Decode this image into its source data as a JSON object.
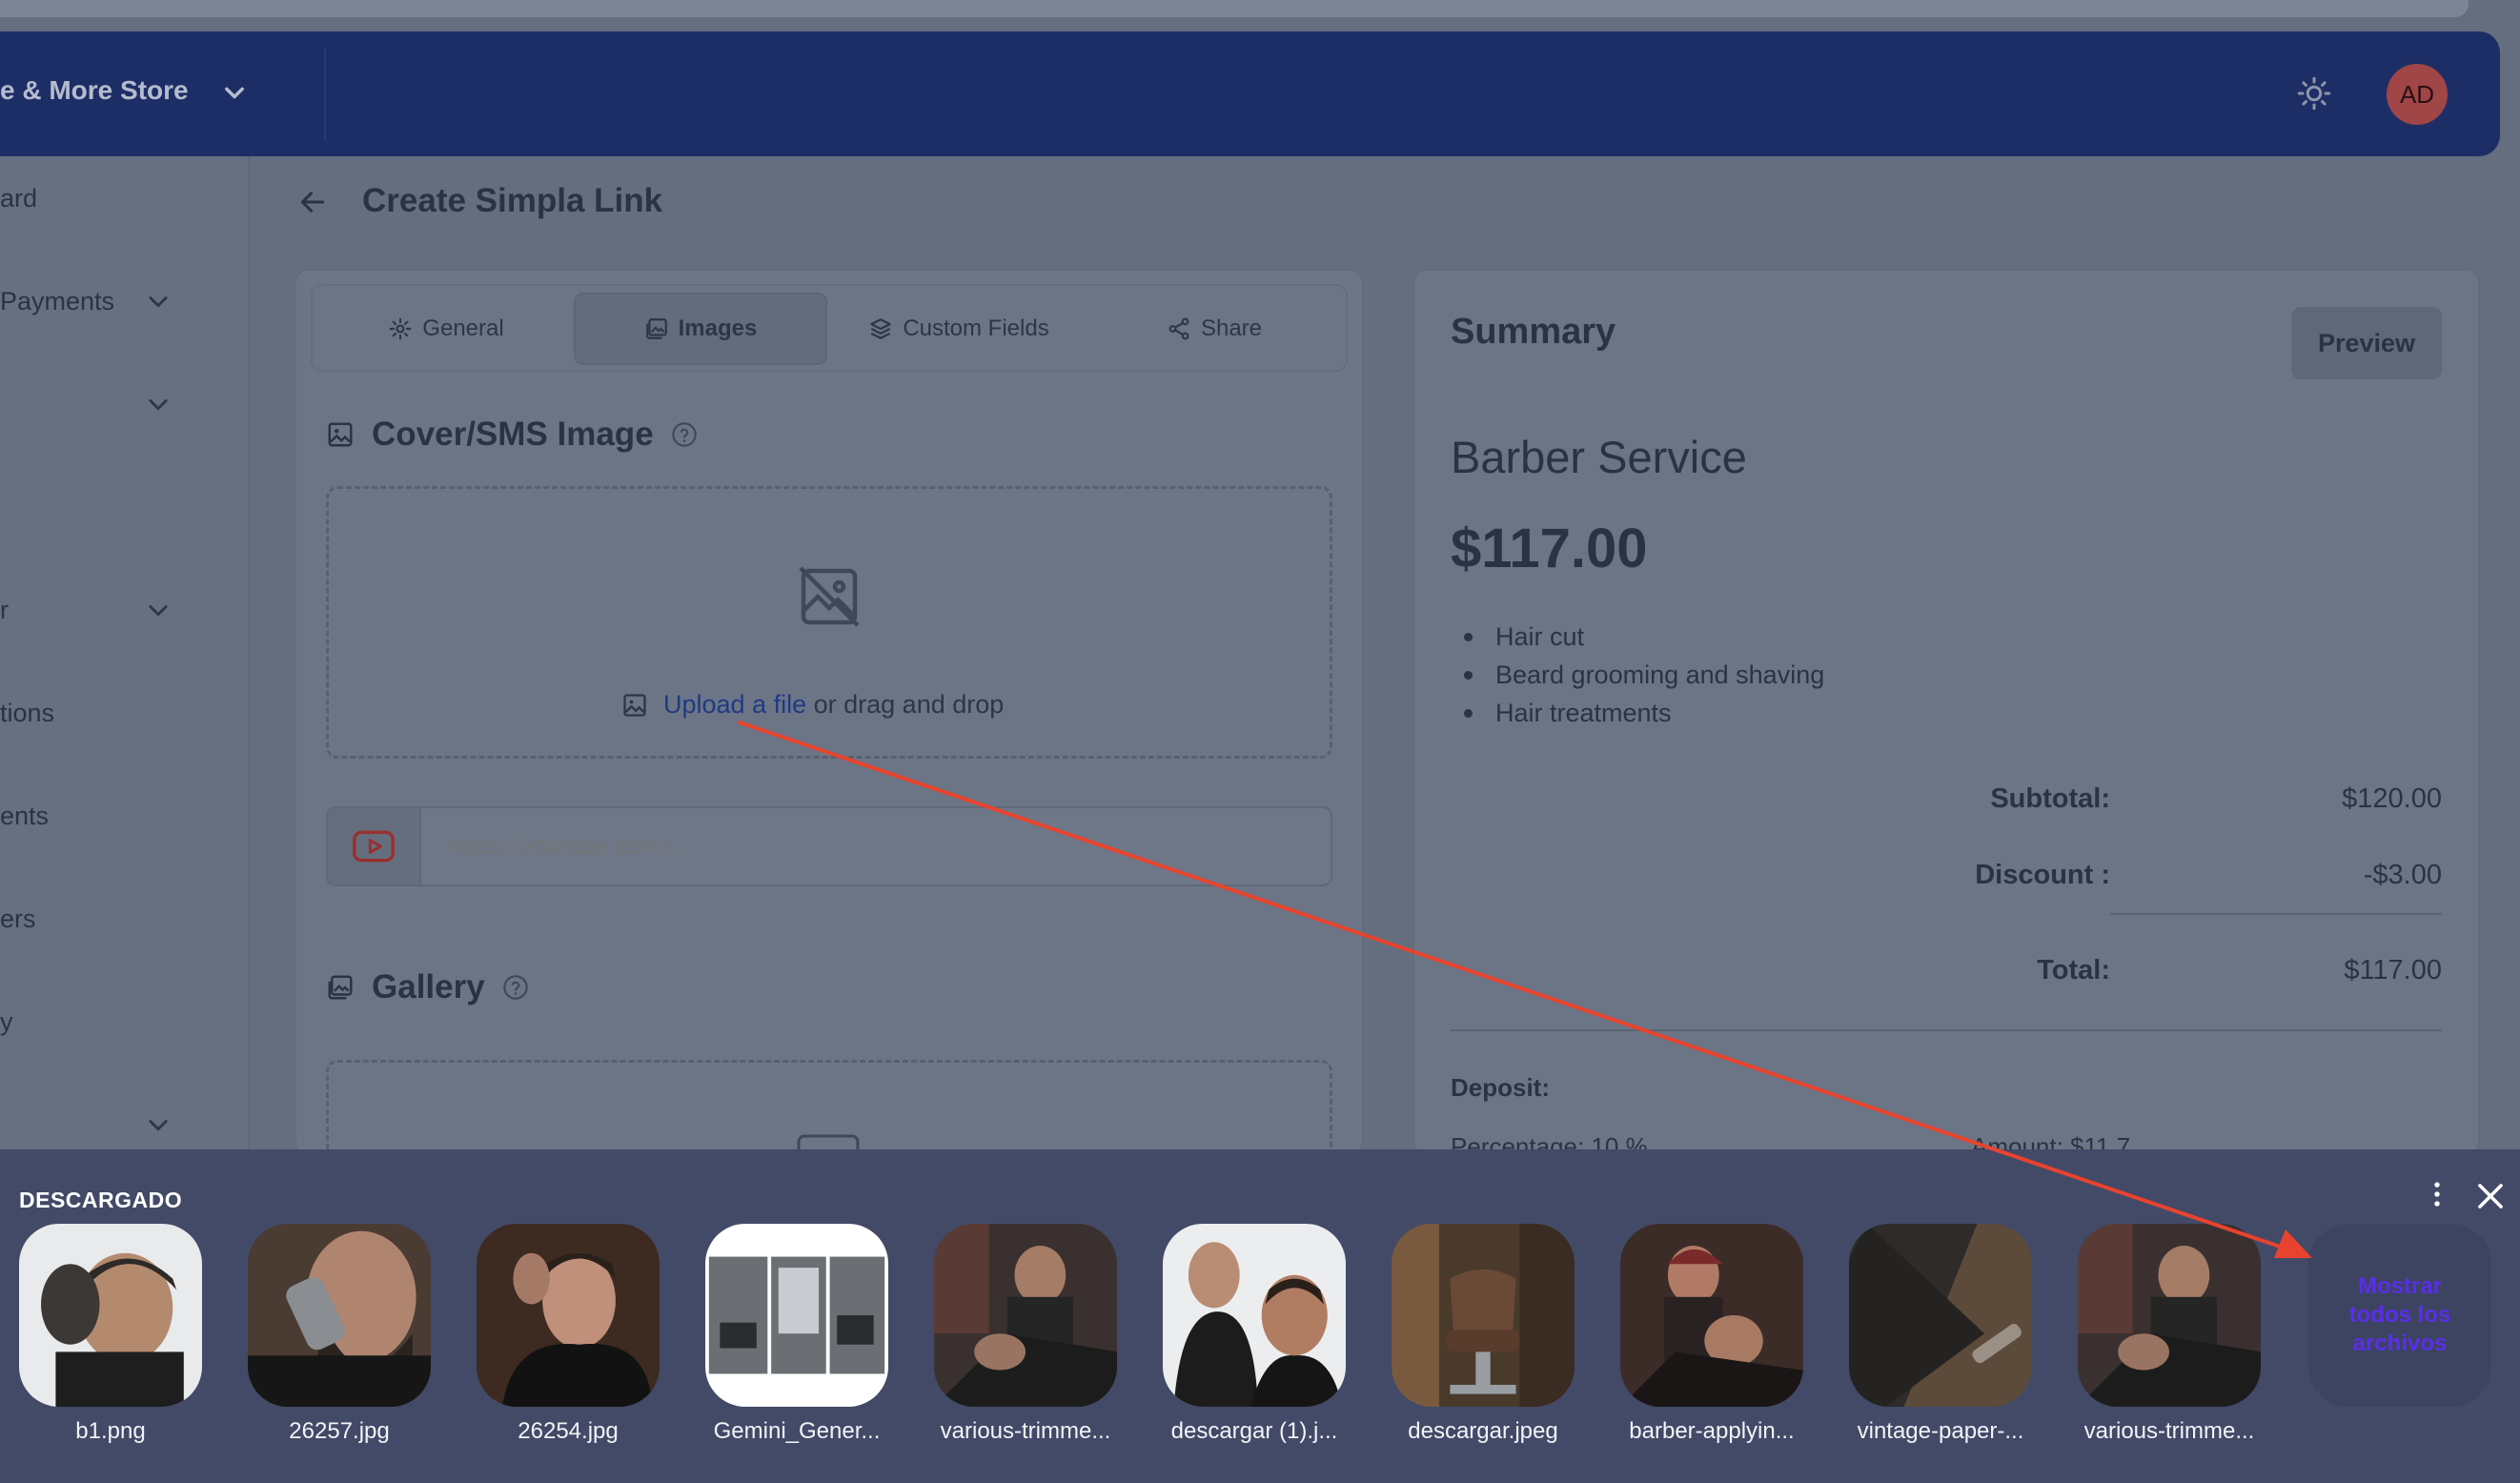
{
  "header": {
    "store_name": "e & More Store",
    "avatar_initials": "AD"
  },
  "sidebar": {
    "items": [
      {
        "label": "ard"
      },
      {
        "label": "Payments"
      },
      {
        "label": "r"
      },
      {
        "label": "tions"
      },
      {
        "label": "ents"
      },
      {
        "label": "ers"
      },
      {
        "label": "y"
      }
    ]
  },
  "page": {
    "title": "Create Simpla Link"
  },
  "tabs": [
    {
      "label": "General",
      "icon": "gear-icon"
    },
    {
      "label": "Images",
      "icon": "image-icon"
    },
    {
      "label": "Custom Fields",
      "icon": "layers-icon"
    },
    {
      "label": "Share",
      "icon": "share-icon"
    }
  ],
  "cover": {
    "title": "Cover/SMS Image",
    "upload_link": "Upload a file",
    "upload_rest": "or drag and drop",
    "video_placeholder": "https://youtube.com/..."
  },
  "gallery": {
    "title": "Gallery"
  },
  "summary": {
    "title": "Summary",
    "preview_label": "Preview",
    "product_name": "Barber Service",
    "price": "$117.00",
    "features": [
      "Hair cut",
      "Beard grooming and shaving",
      "Hair treatments"
    ],
    "subtotal_label": "Subtotal:",
    "subtotal_value": "$120.00",
    "discount_label": "Discount :",
    "discount_value": "-$3.00",
    "total_label": "Total:",
    "total_value": "$117.00",
    "deposit_label": "Deposit:",
    "percentage_text": "Percentage: 10 %",
    "amount_text": "Amount: $11.7"
  },
  "downloads": {
    "title": "DESCARGADO",
    "show_all_label": "Mostrar todos los archivos",
    "files": [
      {
        "name": "b1.png"
      },
      {
        "name": "26257.jpg"
      },
      {
        "name": "26254.jpg"
      },
      {
        "name": "Gemini_Gener..."
      },
      {
        "name": "various-trimme..."
      },
      {
        "name": "descargar (1).j..."
      },
      {
        "name": "descargar.jpeg"
      },
      {
        "name": "barber-applyin..."
      },
      {
        "name": "vintage-paper-..."
      },
      {
        "name": "various-trimme..."
      }
    ]
  },
  "colors": {
    "header": "#1d2e67",
    "annotation_arrow": "#e8432e",
    "show_all_text": "#5b2ee8",
    "shelf": "#434a67"
  }
}
